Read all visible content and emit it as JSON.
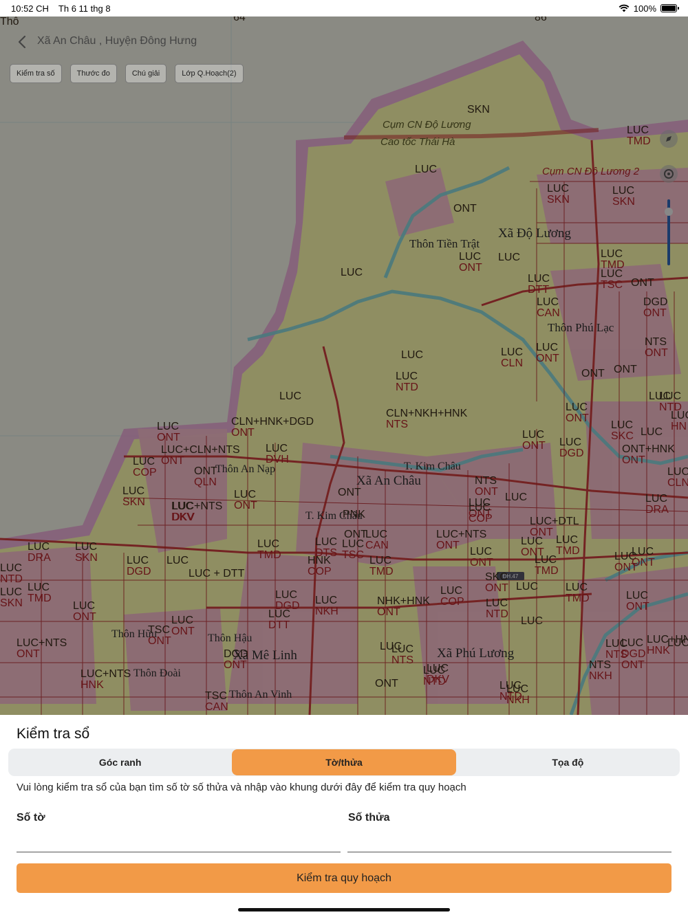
{
  "status_bar": {
    "time": "10:52 CH",
    "date": "Th 6 11 thg 8",
    "battery": "100%",
    "battery_level": 1.0
  },
  "nav": {
    "title": "Xã An Châu , Huyện Đông Hưng",
    "back_icon": "chevron-left-icon"
  },
  "toolbar": {
    "chips": [
      "Kiểm tra số",
      "Thước đo",
      "Chú giải",
      "Lớp Q.Hoạch(2)"
    ]
  },
  "map": {
    "top_numbers": [
      "64",
      "86"
    ],
    "road_sign": "ĐH.47",
    "colors": {
      "agri_land": "#f7f5a9",
      "residential": "#f6c6d0",
      "boundary": "#e9a9d6",
      "water": "#7fd1d8",
      "parcel_line": "#b2242a",
      "base": "#f0efe6",
      "dim_overlay": "rgba(0,0,0,0.42)"
    },
    "places": [
      "Xã Độ Lương",
      "Thôn Tiền Trật",
      "Thôn Phú Lạc",
      "Xã An Châu",
      "Thôn An Nạp",
      "T. Kim Châu",
      "T. Kim Châu",
      "Thôn Hữu",
      "Thôn Hậu",
      "Thôn Đoài",
      "Xã Mê Linh",
      "Thôn An Vinh",
      "Xã Phú Lương"
    ],
    "special": [
      "Cụm CN Độ Lương",
      "Cao tốc Thái Hà",
      "Cụm CN Độ Lương 2"
    ],
    "codes": [
      "SKN",
      "LUC",
      "ONT",
      "LUC",
      "LUC",
      "LUC\nSKN",
      "LUC\nSKN",
      "LUC\nTMD",
      "LUC",
      "LUC\nONT",
      "LUC\nDTT",
      "LUC\nTMD",
      "LUC\nTSC",
      "ONT",
      "DGD\nONT",
      "LUC\nCAN",
      "NTS\nONT",
      "LUC",
      "LUC\nNTD",
      "LUC\nCLN",
      "LUC\nONT",
      "ONT",
      "ONT",
      "LUC",
      "CLN+HNK+DGD\nONT",
      "CLN+NKH+HNK\nNTS",
      "LUC\nNTD",
      "LUC+CLN+NTS\nONT",
      "LUC\nDVH",
      "LUC\nONT",
      "LUC\nONT",
      "LUC\nSKC",
      "LUC",
      "LUC\nHN",
      "LUC\nONT",
      "ONT+HNK\nONT",
      "LUC\nCOP",
      "ONT\nQLN",
      "LUC\nSKN",
      "LUC\nDGD",
      "ONT",
      "LUC\nDKV",
      "NTS\nONT",
      "LUC\nONT",
      "LUC\nCLN",
      "LUC+NTS\nDKV",
      "LUC\nONT",
      "LUC",
      "LUC\nCOP",
      "LUC\nDRA",
      "LUC+DTL\nONT",
      "LUC\nTMD",
      "PNK",
      "ONT",
      "LUC\nCAN",
      "LUC+NTS\nONT",
      "LUC\nONT",
      "LUC\nDRA",
      "LUC\nSKN",
      "LUC\nDGD",
      "LUC\nONT",
      "LUC",
      "LUC\nTMD",
      "LUC\nTSC",
      "LUC\nTMD",
      "LUC\nONT",
      "LUC\nTMD",
      "LUC\nNTD",
      "LUC\nSKN",
      "LUC + DTT",
      "LUC\nDTS",
      "HNK\nCOP",
      "SKC\nONT",
      "LUC",
      "LUC\nCOP",
      "LUC\nTMD",
      "LUC\nTMD",
      "LUC\nONT",
      "LUC\nDGD",
      "LUC\nNKH",
      "NHK+HNK\nONT",
      "LUC\nNTD",
      "LUC",
      "LUC\nNTS",
      "LUC+NTS\nONT",
      "LUC\nONT",
      "TSC\nONT",
      "LUC\nONT",
      "LUC\nDTT",
      "LUC",
      "LUC\nDGD\nONT",
      "NTS\nNKH",
      "LUC\nNTD",
      "LUC\nONT",
      "DGD\nONT",
      "TSC\nCAN",
      "ONT",
      "LUC+NTS\nHNK",
      "LUC\nDKV",
      "LUC\nNTD",
      "LUC\nNKH",
      "LUC+HNK\nHNK",
      "LUC\nNTS",
      "LUC",
      "Thô"
    ]
  },
  "sheet": {
    "title": "Kiểm tra sổ",
    "tabs": [
      "Góc ranh",
      "Tờ/thửa",
      "Tọa độ"
    ],
    "active_tab": "Tờ/thửa",
    "hint": "Vui lòng kiểm tra sổ của bạn tìm số tờ số thửa và nhập vào khung dưới đây để kiểm tra quy hoạch",
    "sheet_label": "Số tờ",
    "sheet_value": "",
    "parcel_label": "Số thửa",
    "parcel_value": "",
    "submit_label": "Kiểm tra quy hoạch",
    "accent": "#f29a47"
  }
}
